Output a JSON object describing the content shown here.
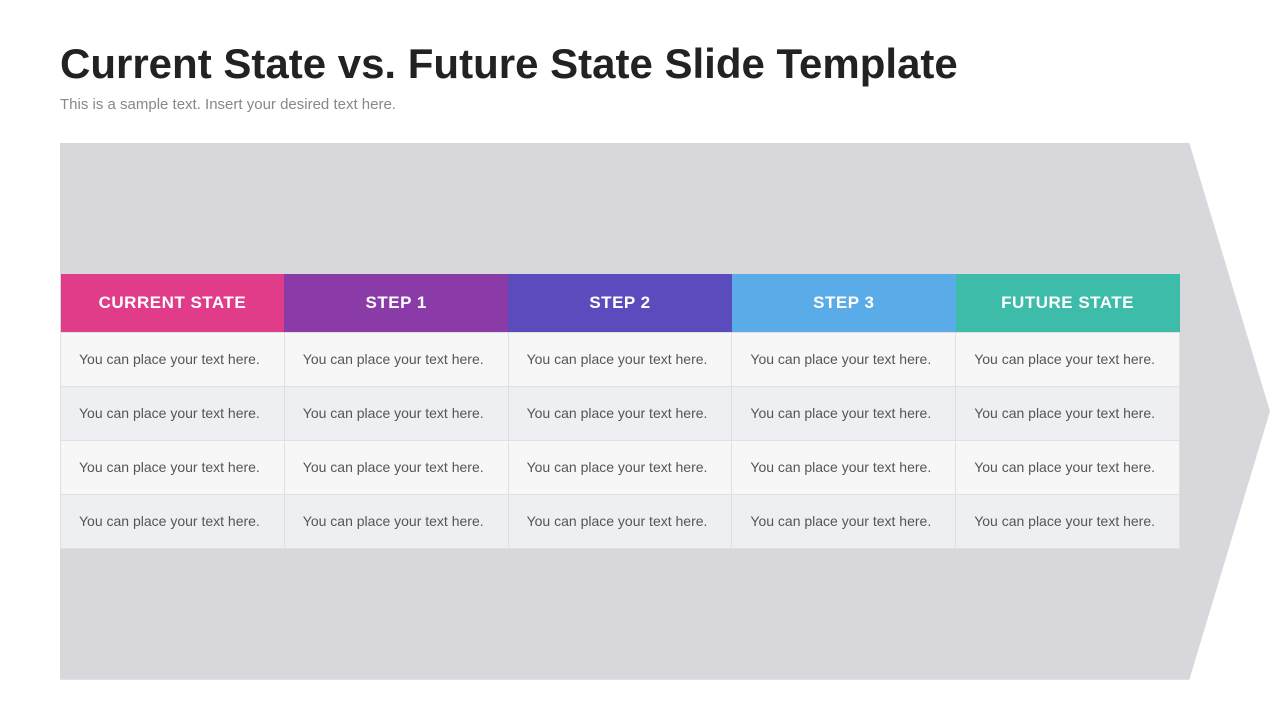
{
  "header": {
    "title": "Current State vs. Future State Slide Template",
    "subtitle": "This is a sample text. Insert your desired text here."
  },
  "columns": [
    {
      "id": "current",
      "label": "CURRENT STATE",
      "class": "col-current"
    },
    {
      "id": "step1",
      "label": "STEP 1",
      "class": "col-step1"
    },
    {
      "id": "step2",
      "label": "STEP 2",
      "class": "col-step2"
    },
    {
      "id": "step3",
      "label": "STEP 3",
      "class": "col-step3"
    },
    {
      "id": "future",
      "label": "FUTURE STATE",
      "class": "col-future"
    }
  ],
  "rows": [
    {
      "cells": [
        "You can place your text here.",
        "You can place your text here.",
        "You can place your text here.",
        "You can place your text here.",
        "You can place your text here."
      ]
    },
    {
      "cells": [
        "You can place your text here.",
        "You can place your text here.",
        "You can place your text here.",
        "You can place your text here.",
        "You can place your text here."
      ]
    },
    {
      "cells": [
        "You can place your text here.",
        "You can place your text here.",
        "You can place your text here.",
        "You can place your text here.",
        "You can place your text here."
      ]
    },
    {
      "cells": [
        "You can place your text here.",
        "You can place your text here.",
        "You can place your text here.",
        "You can place your text here.",
        "You can place your text here."
      ]
    }
  ]
}
